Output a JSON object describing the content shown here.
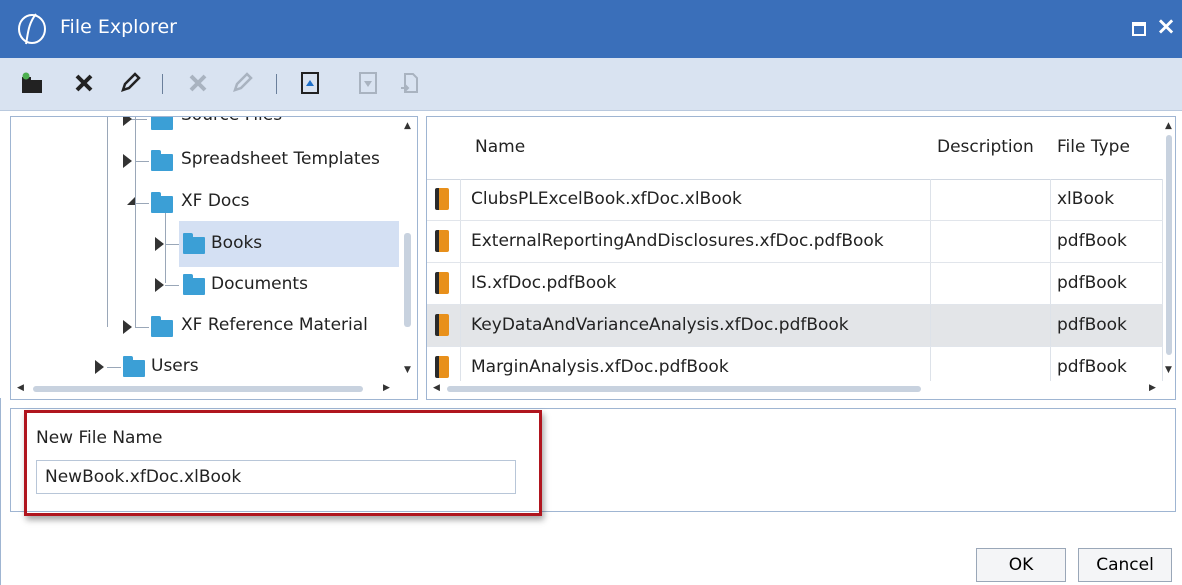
{
  "window": {
    "title": "File Explorer",
    "accent_color": "#3a6fba",
    "maximize_icon": "maximize-icon",
    "close_icon": "close-icon",
    "close_glyph": "×"
  },
  "toolbar": {
    "buttons": [
      {
        "name": "create-folder-icon",
        "glyph": "▰",
        "enabled": true
      },
      {
        "name": "delete-icon",
        "glyph": "✖",
        "enabled": true
      },
      {
        "name": "rename-icon",
        "glyph": "✎",
        "enabled": true
      },
      {
        "name": "delete-disabled-icon",
        "glyph": "✖",
        "enabled": false
      },
      {
        "name": "rename-disabled-icon",
        "glyph": "✎",
        "enabled": false
      },
      {
        "name": "upload-file-icon",
        "glyph": "⇪",
        "enabled": true
      },
      {
        "name": "download-file-icon",
        "glyph": "⇩",
        "enabled": false
      },
      {
        "name": "export-file-icon",
        "glyph": "⎘",
        "enabled": false
      }
    ]
  },
  "tree": {
    "items": [
      {
        "label": "Source Files",
        "state": "collapsed"
      },
      {
        "label": "Spreadsheet Templates",
        "state": "collapsed"
      },
      {
        "label": "XF Docs",
        "state": "expanded"
      },
      {
        "label": "Books",
        "state": "collapsed",
        "selected": true
      },
      {
        "label": "Documents",
        "state": "collapsed"
      },
      {
        "label": "XF Reference Material",
        "state": "collapsed"
      },
      {
        "label": "Users",
        "state": "collapsed"
      }
    ]
  },
  "grid": {
    "columns": [
      "Name",
      "Description",
      "File Type"
    ],
    "rows": [
      {
        "name": "ClubsPLExcelBook.xfDoc.xlBook",
        "description": "",
        "file_type": "xlBook"
      },
      {
        "name": "ExternalReportingAndDisclosures.xfDoc.pdfBook",
        "description": "",
        "file_type": "pdfBook"
      },
      {
        "name": "IS.xfDoc.pdfBook",
        "description": "",
        "file_type": "pdfBook"
      },
      {
        "name": "KeyDataAndVarianceAnalysis.xfDoc.pdfBook",
        "description": "",
        "file_type": "pdfBook",
        "selected": true
      },
      {
        "name": "MarginAnalysis.xfDoc.pdfBook",
        "description": "",
        "file_type": "pdfBook"
      }
    ]
  },
  "new_file": {
    "label": "New File Name",
    "value": "NewBook.xfDoc.xlBook",
    "highlight_color": "#b0151e"
  },
  "buttons": {
    "ok": "OK",
    "cancel": "Cancel"
  }
}
